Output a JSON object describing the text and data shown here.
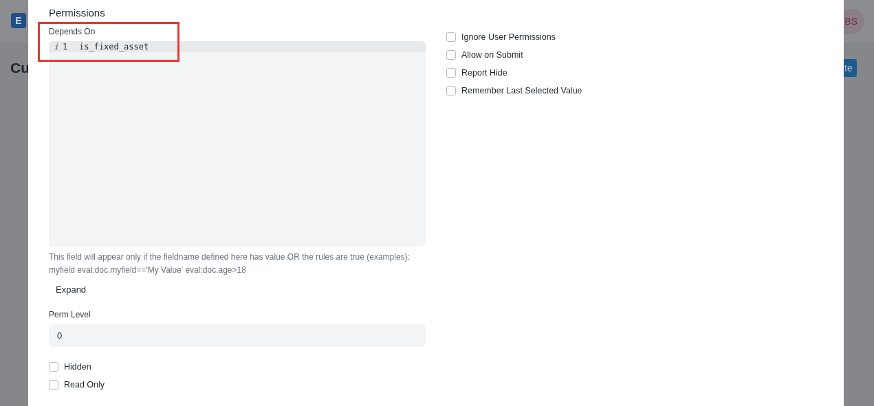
{
  "background": {
    "logo": "E",
    "heading": "Cu",
    "avatar": "BS",
    "button": "te"
  },
  "dialog": {
    "section_title": "Permissions",
    "depends_on": {
      "label": "Depends On",
      "lines": [
        {
          "gutter_mark": "i",
          "number": "1",
          "code": "is_fixed_asset"
        }
      ],
      "help": "This field will appear only if the fieldname defined here has value OR the rules are true (examples): myfield eval:doc.myfield=='My Value' eval:doc.age>18",
      "expand": "Expand"
    },
    "perm_level": {
      "label": "Perm Level",
      "value": "0"
    },
    "left_checks": [
      {
        "label": "Hidden",
        "checked": false
      },
      {
        "label": "Read Only",
        "checked": false
      }
    ],
    "right_checks": [
      {
        "label": "Ignore User Permissions",
        "checked": false
      },
      {
        "label": "Allow on Submit",
        "checked": false
      },
      {
        "label": "Report Hide",
        "checked": false
      },
      {
        "label": "Remember Last Selected Value",
        "checked": false
      }
    ]
  },
  "annotation": {
    "kind": "highlight",
    "color": "#e53935"
  }
}
